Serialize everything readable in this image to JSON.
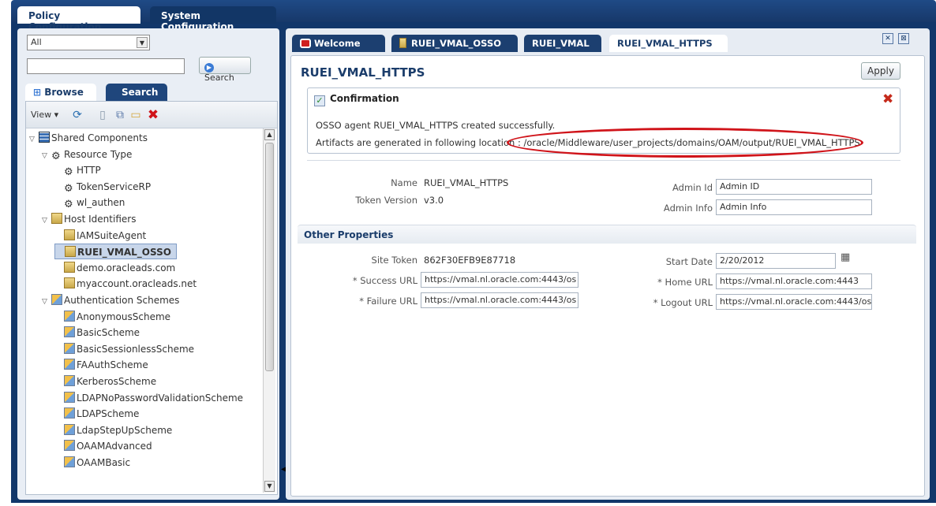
{
  "top_tabs": [
    "Policy Configuration",
    "System Configuration"
  ],
  "left": {
    "filter_value": "All",
    "search_value": "",
    "search_button": "Search",
    "tabs": [
      "Browse",
      "Search"
    ],
    "view_label": "View ▾",
    "tree": [
      {
        "label": "Shared Components",
        "icon": "grid-icon",
        "level": 0,
        "expanded": true
      },
      {
        "label": "Resource Type",
        "icon": "gear-icon",
        "level": 1,
        "expanded": true
      },
      {
        "label": "HTTP",
        "icon": "gear-icon",
        "level": 2
      },
      {
        "label": "TokenServiceRP",
        "icon": "gear-icon",
        "level": 2
      },
      {
        "label": "wl_authen",
        "icon": "gear-icon",
        "level": 2
      },
      {
        "label": "Host Identifiers",
        "icon": "document-icon",
        "level": 1,
        "expanded": true
      },
      {
        "label": "IAMSuiteAgent",
        "icon": "document-icon",
        "level": 2
      },
      {
        "label": "RUEI_VMAL_OSSO",
        "icon": "document-icon",
        "level": 2,
        "selected": true
      },
      {
        "label": "demo.oracleads.com",
        "icon": "document-icon",
        "level": 2
      },
      {
        "label": "myaccount.oracleads.net",
        "icon": "document-icon",
        "level": 2
      },
      {
        "label": "Authentication Schemes",
        "icon": "scheme-icon",
        "level": 1,
        "expanded": true
      },
      {
        "label": "AnonymousScheme",
        "icon": "scheme-icon",
        "level": 2
      },
      {
        "label": "BasicScheme",
        "icon": "scheme-icon",
        "level": 2
      },
      {
        "label": "BasicSessionlessScheme",
        "icon": "scheme-icon",
        "level": 2
      },
      {
        "label": "FAAuthScheme",
        "icon": "scheme-icon",
        "level": 2
      },
      {
        "label": "KerberosScheme",
        "icon": "scheme-icon",
        "level": 2
      },
      {
        "label": "LDAPNoPasswordValidationScheme",
        "icon": "scheme-icon",
        "level": 2
      },
      {
        "label": "LDAPScheme",
        "icon": "scheme-icon",
        "level": 2
      },
      {
        "label": "LdapStepUpScheme",
        "icon": "scheme-icon",
        "level": 2
      },
      {
        "label": "OAAMAdvanced",
        "icon": "scheme-icon",
        "level": 2
      },
      {
        "label": "OAAMBasic",
        "icon": "scheme-icon",
        "level": 2
      }
    ]
  },
  "right": {
    "tabs": [
      "Welcome",
      "RUEI_VMAL_OSSO",
      "RUEI_VMAL",
      "RUEI_VMAL_HTTPS"
    ],
    "active_tab": "RUEI_VMAL_HTTPS",
    "title": "RUEI_VMAL_HTTPS",
    "apply_label": "Apply",
    "confirmation": {
      "title": "Confirmation",
      "line1": "OSSO agent RUEI_VMAL_HTTPS created successfully.",
      "line2": "Artifacts are generated in following location : /oracle/Middleware/user_projects/domains/OAM/output/RUEI_VMAL_HTTPS"
    },
    "name_label": "Name",
    "name_value": "RUEI_VMAL_HTTPS",
    "token_version_label": "Token Version",
    "token_version_value": "v3.0",
    "admin_id_label": "Admin Id",
    "admin_id_value": "Admin ID",
    "admin_info_label": "Admin Info",
    "admin_info_value": "Admin Info",
    "other_properties": "Other Properties",
    "site_token_label": "Site Token",
    "site_token_value": "862F30EFB9E87718",
    "success_url_label": "* Success URL",
    "success_url_value": "https://vmal.nl.oracle.com:4443/os",
    "failure_url_label": "* Failure URL",
    "failure_url_value": "https://vmal.nl.oracle.com:4443/os",
    "start_date_label": "Start Date",
    "start_date_value": "2/20/2012",
    "home_url_label": "* Home URL",
    "home_url_value": "https://vmal.nl.oracle.com:4443",
    "logout_url_label": "* Logout URL",
    "logout_url_value": "https://vmal.nl.oracle.com:4443/os"
  },
  "colors": {
    "header_blue": "#12376a",
    "highlight_red": "#d0141a",
    "title_blue": "#1b3d6b"
  }
}
